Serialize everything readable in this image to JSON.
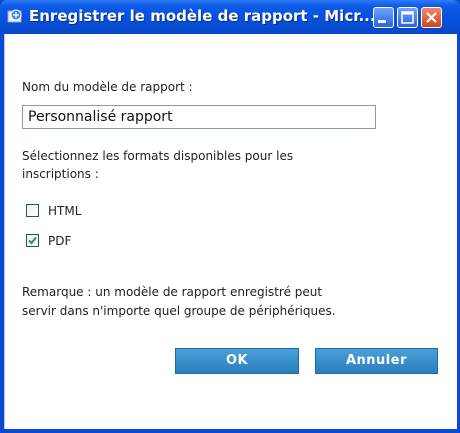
{
  "window": {
    "title": "Enregistrer le modèle de rapport - Micr..."
  },
  "form": {
    "name_label": "Nom du modèle de rapport :",
    "name_value": "Personnalisé rapport",
    "formats_label_line1": "Sélectionnez les formats disponibles pour les",
    "formats_label_line2": "inscriptions :",
    "formats": [
      {
        "label": "HTML",
        "checked": false
      },
      {
        "label": "PDF",
        "checked": true
      }
    ],
    "note_line1": "Remarque : un modèle de rapport enregistré peut",
    "note_line2": "servir dans n'importe quel groupe de périphériques."
  },
  "buttons": {
    "ok": "OK",
    "cancel": "Annuler"
  },
  "colors": {
    "titlebar": "#0650db",
    "button": "#2a7fbe",
    "check": "#2a9a2a"
  }
}
